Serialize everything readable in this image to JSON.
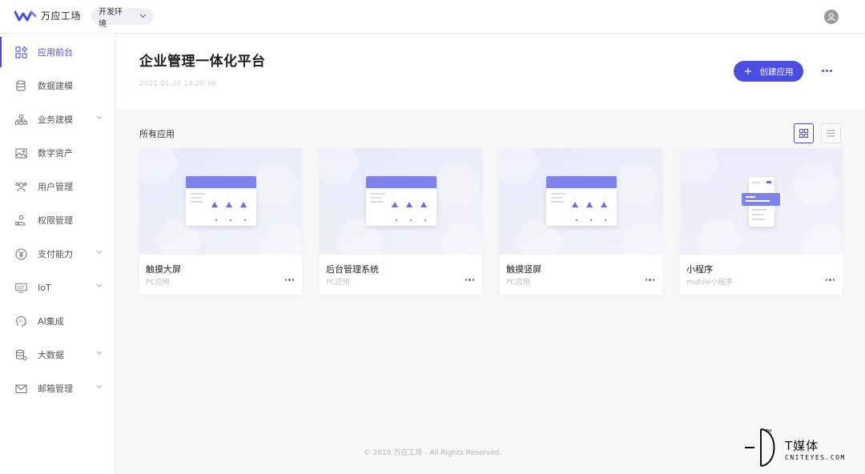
{
  "app": {
    "name": "万应工场",
    "environment": "开发环境"
  },
  "sidebar": {
    "items": [
      {
        "label": "应用前台",
        "icon": "apps-grid-icon",
        "active": true,
        "expandable": false
      },
      {
        "label": "数据建模",
        "icon": "database-icon",
        "active": false,
        "expandable": false
      },
      {
        "label": "业务建模",
        "icon": "org-tree-icon",
        "active": false,
        "expandable": true
      },
      {
        "label": "数字资产",
        "icon": "image-frame-icon",
        "active": false,
        "expandable": false
      },
      {
        "label": "用户管理",
        "icon": "users-icon",
        "active": false,
        "expandable": false
      },
      {
        "label": "权限管理",
        "icon": "permission-icon",
        "active": false,
        "expandable": false
      },
      {
        "label": "支付能力",
        "icon": "yen-icon",
        "active": false,
        "expandable": true
      },
      {
        "label": "IoT",
        "icon": "iot-icon",
        "active": false,
        "expandable": true
      },
      {
        "label": "AI集成",
        "icon": "ai-head-icon",
        "active": false,
        "expandable": false
      },
      {
        "label": "大数据",
        "icon": "big-data-icon",
        "active": false,
        "expandable": true
      },
      {
        "label": "邮箱管理",
        "icon": "mail-icon",
        "active": false,
        "expandable": true
      }
    ]
  },
  "header": {
    "title": "企业管理一体化平台",
    "timestamp": "2021-01-20 14:20:36",
    "create_button": "创建应用"
  },
  "main": {
    "section_title": "所有应用",
    "apps": [
      {
        "name": "触摸大屏",
        "type": "PC应用",
        "preview": "pc"
      },
      {
        "name": "后台管理系统",
        "type": "PC应用",
        "preview": "pc"
      },
      {
        "name": "触摸竖屏",
        "type": "PC应用",
        "preview": "pc"
      },
      {
        "name": "小程序",
        "type": "mobile小程序",
        "preview": "mobile"
      }
    ]
  },
  "footer": {
    "copyright": "© 2019 万应工场 - All Rights Reserved."
  },
  "watermark": {
    "brand": "T媒体",
    "site": "CNITEYES.COM"
  },
  "colors": {
    "accent": "#4b4ee0",
    "thumb_accent": "#7e83ea"
  }
}
